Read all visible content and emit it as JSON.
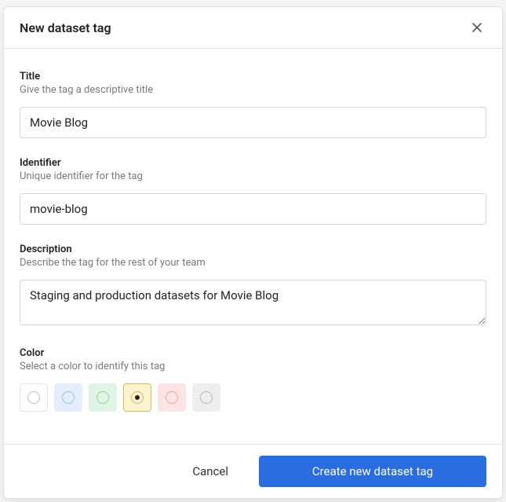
{
  "modal": {
    "title": "New dataset tag",
    "fields": {
      "title": {
        "label": "Title",
        "hint": "Give the tag a descriptive title",
        "value": "Movie Blog"
      },
      "identifier": {
        "label": "Identifier",
        "hint": "Unique identifier for the tag",
        "value": "movie-blog"
      },
      "description": {
        "label": "Description",
        "hint": "Describe the tag for the rest of your team",
        "value": "Staging and production datasets for Movie Blog"
      },
      "color": {
        "label": "Color",
        "hint": "Select a color to identify this tag",
        "options": [
          {
            "name": "white",
            "bg": "#ffffff",
            "ring": "#bfbfbf",
            "selected": false
          },
          {
            "name": "blue",
            "bg": "#e3edfb",
            "ring": "#9bbdf0",
            "selected": false
          },
          {
            "name": "green",
            "bg": "#def4e4",
            "ring": "#8cd6a3",
            "selected": false
          },
          {
            "name": "yellow",
            "bg": "#fdf3d1",
            "ring": "#d9b94f",
            "selected": true
          },
          {
            "name": "red",
            "bg": "#fde4e4",
            "ring": "#e9a6a6",
            "selected": false
          },
          {
            "name": "gray",
            "bg": "#eeeeee",
            "ring": "#b7b7b7",
            "selected": false
          }
        ]
      }
    },
    "footer": {
      "cancel": "Cancel",
      "submit": "Create new dataset tag"
    }
  }
}
